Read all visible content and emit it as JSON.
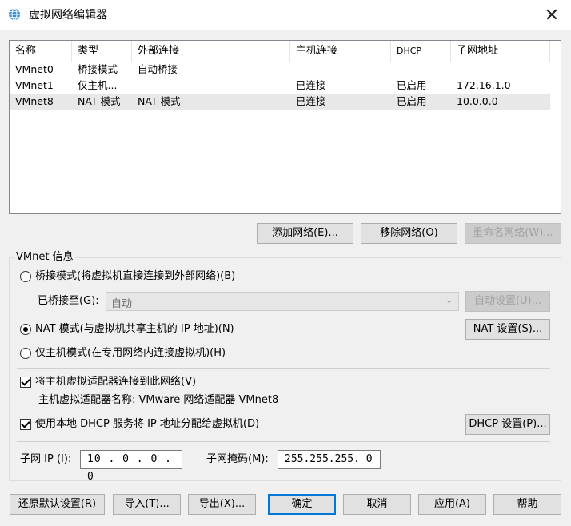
{
  "window": {
    "title": "虚拟网络编辑器"
  },
  "table": {
    "columns": [
      "名称",
      "类型",
      "外部连接",
      "主机连接",
      "DHCP",
      "子网地址"
    ],
    "rows": [
      {
        "name": "VMnet0",
        "type": "桥接模式",
        "external": "自动桥接",
        "host": "-",
        "dhcp": "-",
        "subnet": "-",
        "selected": false
      },
      {
        "name": "VMnet1",
        "type": "仅主机...",
        "external": "-",
        "host": "已连接",
        "dhcp": "已启用",
        "subnet": "172.16.1.0",
        "selected": false
      },
      {
        "name": "VMnet8",
        "type": "NAT 模式",
        "external": "NAT 模式",
        "host": "已连接",
        "dhcp": "已启用",
        "subnet": "10.0.0.0",
        "selected": true
      }
    ]
  },
  "list_buttons": {
    "add": "添加网络(E)...",
    "remove": "移除网络(O)",
    "rename": "重命名网络(W)..."
  },
  "vmnet_info": {
    "label": "VMnet 信息",
    "bridge_mode": "桥接模式(将虚拟机直接连接到外部网络)(B)",
    "bridged_to_label": "已桥接至(G):",
    "bridged_to_value": "自动",
    "auto_settings": "自动设置(U)...",
    "nat_mode": "NAT 模式(与虚拟机共享主机的 IP 地址)(N)",
    "nat_settings": "NAT 设置(S)...",
    "host_only": "仅主机模式(在专用网络内连接虚拟机)(H)",
    "connect_adapter": "将主机虚拟适配器连接到此网络(V)",
    "adapter_name": "主机虚拟适配器名称: VMware 网络适配器 VMnet8",
    "use_dhcp": "使用本地 DHCP 服务将 IP 地址分配给虚拟机(D)",
    "dhcp_settings": "DHCP 设置(P)...",
    "subnet_ip_label": "子网 IP (I):",
    "subnet_ip": "10 . 0 . 0 . 0",
    "subnet_mask_label": "子网掩码(M):",
    "subnet_mask": "255.255.255. 0",
    "selected_mode": "nat",
    "connect_adapter_checked": true,
    "use_dhcp_checked": true
  },
  "footer": {
    "restore": "还原默认设置(R)",
    "import": "导入(T)...",
    "export": "导出(X)...",
    "ok": "确定",
    "cancel": "取消",
    "apply": "应用(A)",
    "help": "帮助"
  },
  "icons": {
    "app": "globe-network-icon",
    "close": "close-icon",
    "dropdown": "chevron-down-icon"
  },
  "colors": {
    "accent": "#0078d7",
    "selection": "#e8e8e8",
    "window_bg": "#f0f0f0"
  }
}
